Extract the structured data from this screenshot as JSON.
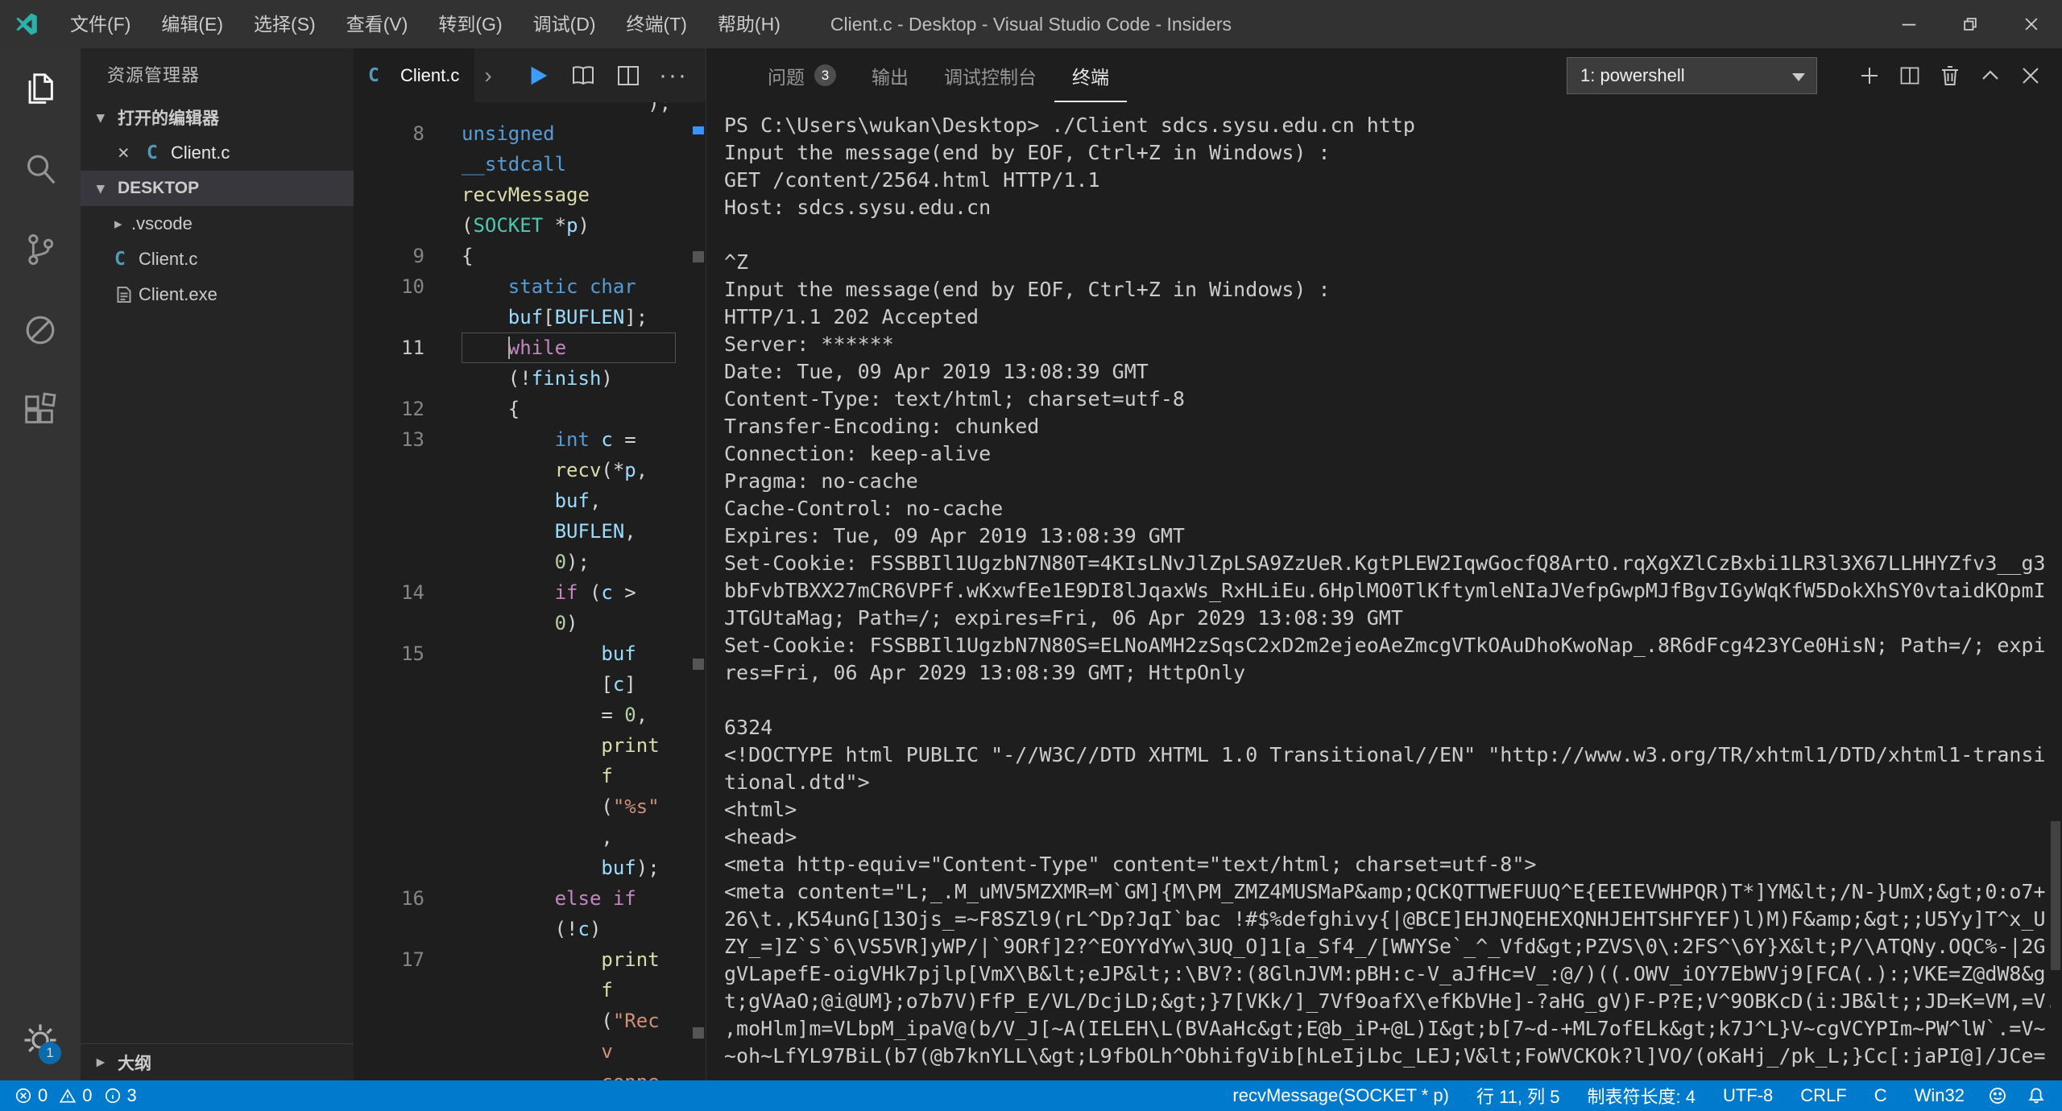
{
  "colors": {
    "accent": "#007acc",
    "titlebar_bg": "#323233",
    "activitybar_bg": "#333333",
    "sidebar_bg": "#252526",
    "editor_bg": "#1e1e1e",
    "c_file_icon": "#519aba",
    "token_keyword": "#569cd6",
    "token_control": "#c586c0",
    "token_function": "#dcdcaa",
    "token_variable": "#9cdcfe",
    "token_type": "#4ec9b0",
    "token_string": "#ce9178",
    "token_number": "#b5cea8"
  },
  "titlebar": {
    "menus": [
      "文件(F)",
      "编辑(E)",
      "选择(S)",
      "查看(V)",
      "转到(G)",
      "调试(D)",
      "终端(T)",
      "帮助(H)"
    ],
    "title": "Client.c - Desktop - Visual Studio Code - Insiders"
  },
  "activitybar": {
    "items": [
      "explorer",
      "search",
      "source-control",
      "debug",
      "extensions"
    ],
    "settings_badge": "1"
  },
  "sidebar": {
    "title": "资源管理器",
    "open_editors": {
      "label": "打开的编辑器",
      "items": [
        {
          "name": "Client.c"
        }
      ]
    },
    "folder": {
      "label": "DESKTOP",
      "items": [
        {
          "name": ".vscode",
          "type": "folder"
        },
        {
          "name": "Client.c",
          "type": "c"
        },
        {
          "name": "Client.exe",
          "type": "exe"
        }
      ]
    },
    "outline_label": "大纲"
  },
  "editor": {
    "tab": {
      "label": "Client.c"
    },
    "code_rows": [
      {
        "n": "",
        "s": [
          [
            "                );",
            "d"
          ]
        ]
      },
      {
        "n": "8",
        "s": [
          [
            "unsigned",
            "k"
          ]
        ]
      },
      {
        "n": "",
        "s": [
          [
            "__stdcall",
            "k"
          ]
        ]
      },
      {
        "n": "",
        "s": [
          [
            "recvMessage",
            "f"
          ]
        ]
      },
      {
        "n": "",
        "s": [
          [
            "(",
            "d"
          ],
          [
            "SOCKET",
            "t"
          ],
          [
            " *",
            "d"
          ],
          [
            "p",
            "v"
          ],
          [
            ")",
            "d"
          ]
        ]
      },
      {
        "n": "9",
        "s": [
          [
            "{",
            "d"
          ]
        ]
      },
      {
        "n": "10",
        "s": [
          [
            "    ",
            "d"
          ],
          [
            "static",
            "k"
          ],
          [
            " ",
            "d"
          ],
          [
            "char",
            "k"
          ]
        ]
      },
      {
        "n": "",
        "s": [
          [
            "    ",
            "d"
          ],
          [
            "buf",
            "v"
          ],
          [
            "[",
            "d"
          ],
          [
            "BUFLEN",
            "v"
          ],
          [
            "];",
            "d"
          ]
        ]
      },
      {
        "n": "11",
        "cur": true,
        "s": [
          [
            "    ",
            "d"
          ],
          [
            "while",
            "c"
          ]
        ]
      },
      {
        "n": "",
        "s": [
          [
            "    (!",
            "d"
          ],
          [
            "finish",
            "v"
          ],
          [
            ")",
            "d"
          ]
        ]
      },
      {
        "n": "12",
        "s": [
          [
            "    {",
            "d"
          ]
        ]
      },
      {
        "n": "13",
        "s": [
          [
            "        ",
            "d"
          ],
          [
            "int",
            "k"
          ],
          [
            " ",
            "d"
          ],
          [
            "c",
            "v"
          ],
          [
            " =",
            "d"
          ]
        ]
      },
      {
        "n": "",
        "s": [
          [
            "        ",
            "d"
          ],
          [
            "recv",
            "f"
          ],
          [
            "(*",
            "d"
          ],
          [
            "p",
            "v"
          ],
          [
            ",",
            "d"
          ]
        ]
      },
      {
        "n": "",
        "s": [
          [
            "        ",
            "d"
          ],
          [
            "buf",
            "v"
          ],
          [
            ",",
            "d"
          ]
        ]
      },
      {
        "n": "",
        "s": [
          [
            "        ",
            "d"
          ],
          [
            "BUFLEN",
            "v"
          ],
          [
            ",",
            "d"
          ]
        ]
      },
      {
        "n": "",
        "s": [
          [
            "        ",
            "d"
          ],
          [
            "0",
            "n"
          ],
          [
            ");",
            "d"
          ]
        ]
      },
      {
        "n": "14",
        "s": [
          [
            "        ",
            "d"
          ],
          [
            "if",
            "c"
          ],
          [
            " (",
            "d"
          ],
          [
            "c",
            "v"
          ],
          [
            " >",
            "d"
          ]
        ]
      },
      {
        "n": "",
        "s": [
          [
            "        ",
            "d"
          ],
          [
            "0",
            "n"
          ],
          [
            ")",
            "d"
          ]
        ]
      },
      {
        "n": "15",
        "s": [
          [
            "            ",
            "d"
          ],
          [
            "buf",
            "v"
          ]
        ]
      },
      {
        "n": "",
        "s": [
          [
            "            [",
            "d"
          ],
          [
            "c",
            "v"
          ],
          [
            "]",
            "d"
          ]
        ]
      },
      {
        "n": "",
        "s": [
          [
            "            = ",
            "d"
          ],
          [
            "0",
            "n"
          ],
          [
            ",",
            "d"
          ]
        ]
      },
      {
        "n": "",
        "s": [
          [
            "            ",
            "d"
          ],
          [
            "print",
            "f"
          ]
        ]
      },
      {
        "n": "",
        "s": [
          [
            "            ",
            "d"
          ],
          [
            "f",
            "f"
          ]
        ]
      },
      {
        "n": "",
        "s": [
          [
            "            (",
            "d"
          ],
          [
            "\"%s\"",
            "s"
          ]
        ]
      },
      {
        "n": "",
        "s": [
          [
            "            ,",
            "d"
          ]
        ]
      },
      {
        "n": "",
        "s": [
          [
            "            ",
            "d"
          ],
          [
            "buf",
            "v"
          ],
          [
            ");",
            "d"
          ]
        ]
      },
      {
        "n": "16",
        "s": [
          [
            "        ",
            "d"
          ],
          [
            "else",
            "c"
          ],
          [
            " ",
            "d"
          ],
          [
            "if",
            "c"
          ]
        ]
      },
      {
        "n": "",
        "s": [
          [
            "        (!",
            "d"
          ],
          [
            "c",
            "v"
          ],
          [
            ")",
            "d"
          ]
        ]
      },
      {
        "n": "17",
        "s": [
          [
            "            ",
            "d"
          ],
          [
            "print",
            "f"
          ]
        ]
      },
      {
        "n": "",
        "s": [
          [
            "            ",
            "d"
          ],
          [
            "f",
            "f"
          ]
        ]
      },
      {
        "n": "",
        "s": [
          [
            "            (",
            "d"
          ],
          [
            "\"Rec",
            "s"
          ]
        ]
      },
      {
        "n": "",
        "s": [
          [
            "            ",
            "d"
          ],
          [
            "v",
            "s"
          ]
        ]
      },
      {
        "n": "",
        "s": [
          [
            "            ",
            "d"
          ],
          [
            "conne",
            "s"
          ]
        ]
      }
    ]
  },
  "panel": {
    "tabs": [
      {
        "label": "问题",
        "badge": "3"
      },
      {
        "label": "输出"
      },
      {
        "label": "调试控制台"
      },
      {
        "label": "终端",
        "active": true
      }
    ],
    "terminal_select": "1: powershell",
    "terminal_lines": [
      "PS C:\\Users\\wukan\\Desktop> ./Client sdcs.sysu.edu.cn http",
      "Input the message(end by EOF, Ctrl+Z in Windows) :",
      "GET /content/2564.html HTTP/1.1",
      "Host: sdcs.sysu.edu.cn",
      "",
      "^Z",
      "Input the message(end by EOF, Ctrl+Z in Windows) :",
      "HTTP/1.1 202 Accepted",
      "Server: ******",
      "Date: Tue, 09 Apr 2019 13:08:39 GMT",
      "Content-Type: text/html; charset=utf-8",
      "Transfer-Encoding: chunked",
      "Connection: keep-alive",
      "Pragma: no-cache",
      "Cache-Control: no-cache",
      "Expires: Tue, 09 Apr 2019 13:08:39 GMT",
      "Set-Cookie: FSSBBIl1UgzbN7N80T=4KIsLNvJlZpLSA9ZzUeR.KgtPLEW2IqwGocfQ8ArtO.rqXgXZlCzBxbi1LR3l3X67LLHHYZfv3__g3",
      "bbFvbTBXX27mCR6VPFf.wKxwfEe1E9DI8lJqaxWs_RxHLiEu.6HplMO0TlKftymleNIaJVefpGwpMJfBgvIGyWqKfW5DokXhSY0vtaidKOpmI",
      "JTGUtaMag; Path=/; expires=Fri, 06 Apr 2029 13:08:39 GMT",
      "Set-Cookie: FSSBBIl1UgzbN7N80S=ELNoAMH2zSqsC2xD2m2ejeoAeZmcgVTkOAuDhoKwoNap_.8R6dFcg423YCe0HisN; Path=/; expi",
      "res=Fri, 06 Apr 2029 13:08:39 GMT; HttpOnly",
      "",
      "6324",
      "<!DOCTYPE html PUBLIC \"-//W3C//DTD XHTML 1.0 Transitional//EN\" \"http://www.w3.org/TR/xhtml1/DTD/xhtml1-transi",
      "tional.dtd\">",
      "<html>",
      "<head>",
      "<meta http-equiv=\"Content-Type\" content=\"text/html; charset=utf-8\">",
      "<meta content=\"L;_.M_uMV5MZXMR=M`GM]{M\\PM_ZMZ4MUSMaP&amp;QCKQTTWEFUUQ^E{EEIEVWHPQR)T*]YM&lt;/N-}UmX;&gt;0:o7+",
      "26\\t.,K54unG[13Ojs_=~F8SZl9(rL^Dp?JqI`bac !#$%defghivy{|@BCE]EHJNQEHEXQNHJEHTSHFYEF)l)M)F&amp;&gt;;U5Yy]T^x_U",
      "ZY_=]Z`S`6\\VS5VR]yWP/|`9ORf]2?^EOYYdYw\\3UQ_O]1[a_Sf4_/[WWYSe`_^_Vfd&gt;PZVS\\0\\:2FS^\\6Y}X&lt;P/\\ATQNy.OQC%-|2G",
      "gVLapefE-oigVHk7pjlp[VmX\\B&lt;eJP&lt;:\\BV?:(8GlnJVM:pBH:c-V_aJfHc=V_:@/)((.OWV_iOY7EbWVj9[FCA(.):;VKE=Z@dW8&g",
      "t;gVAaO;@i@UM};o7b7V)FfP_E/VL/DcjLD;&gt;}7[VKk/]_7Vf9oafX\\efKbVHe]-?aHG_gV)F-P?E;V^9OBKcD(i:JB&lt;;JD=K=VM,=V.",
      ",moHlm]m=VLbpM_ipaV@(b/V_J[~A(IELEH\\L(BVAaHc&gt;E@b_iP+@L)I&gt;b[7~d-+ML7ofELk&gt;k7J^L}V~cgVCYPIm~PW^lW`.=V~",
      "~oh~LfYL97BiL(b7(@b7knYLL\\&gt;L9fbOLh^ObhifgVib[hLeIjLbc_LEJ;V&lt;FoWVCKOk?l]VO/(oKaHj_/pk_L;}Cc[:jaPI@]/JCe="
    ]
  },
  "statusbar": {
    "errors": "0",
    "warnings": "0",
    "infos": "3",
    "items": [
      "recvMessage(SOCKET * p)",
      "行 11, 列 5",
      "制表符长度: 4",
      "UTF-8",
      "CRLF",
      "C",
      "Win32"
    ]
  }
}
